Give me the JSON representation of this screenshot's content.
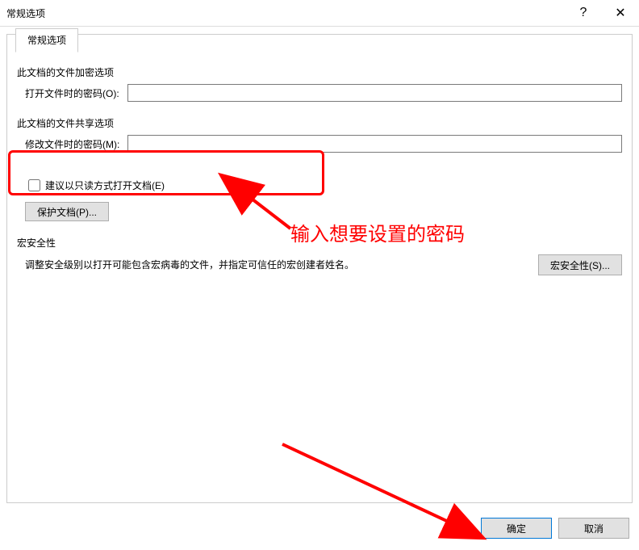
{
  "window": {
    "title": "常规选项",
    "helpGlyph": "?",
    "closeGlyph": "✕"
  },
  "tab": {
    "label": "常规选项"
  },
  "encrypt": {
    "section": "此文档的文件加密选项",
    "openPwdLabel": "打开文件时的密码(O):",
    "openPwdValue": ""
  },
  "share": {
    "section": "此文档的文件共享选项",
    "modifyPwdLabel": "修改文件时的密码(M):",
    "modifyPwdValue": "",
    "readonlyLabel": "建议以只读方式打开文档(E)",
    "readonlyChecked": false,
    "protectBtn": "保护文档(P)..."
  },
  "macro": {
    "section": "宏安全性",
    "text": "调整安全级别以打开可能包含宏病毒的文件，并指定可信任的宏创建者姓名。",
    "btn": "宏安全性(S)..."
  },
  "footer": {
    "ok": "确定",
    "cancel": "取消"
  },
  "annotation": {
    "text": "输入想要设置的密码"
  }
}
